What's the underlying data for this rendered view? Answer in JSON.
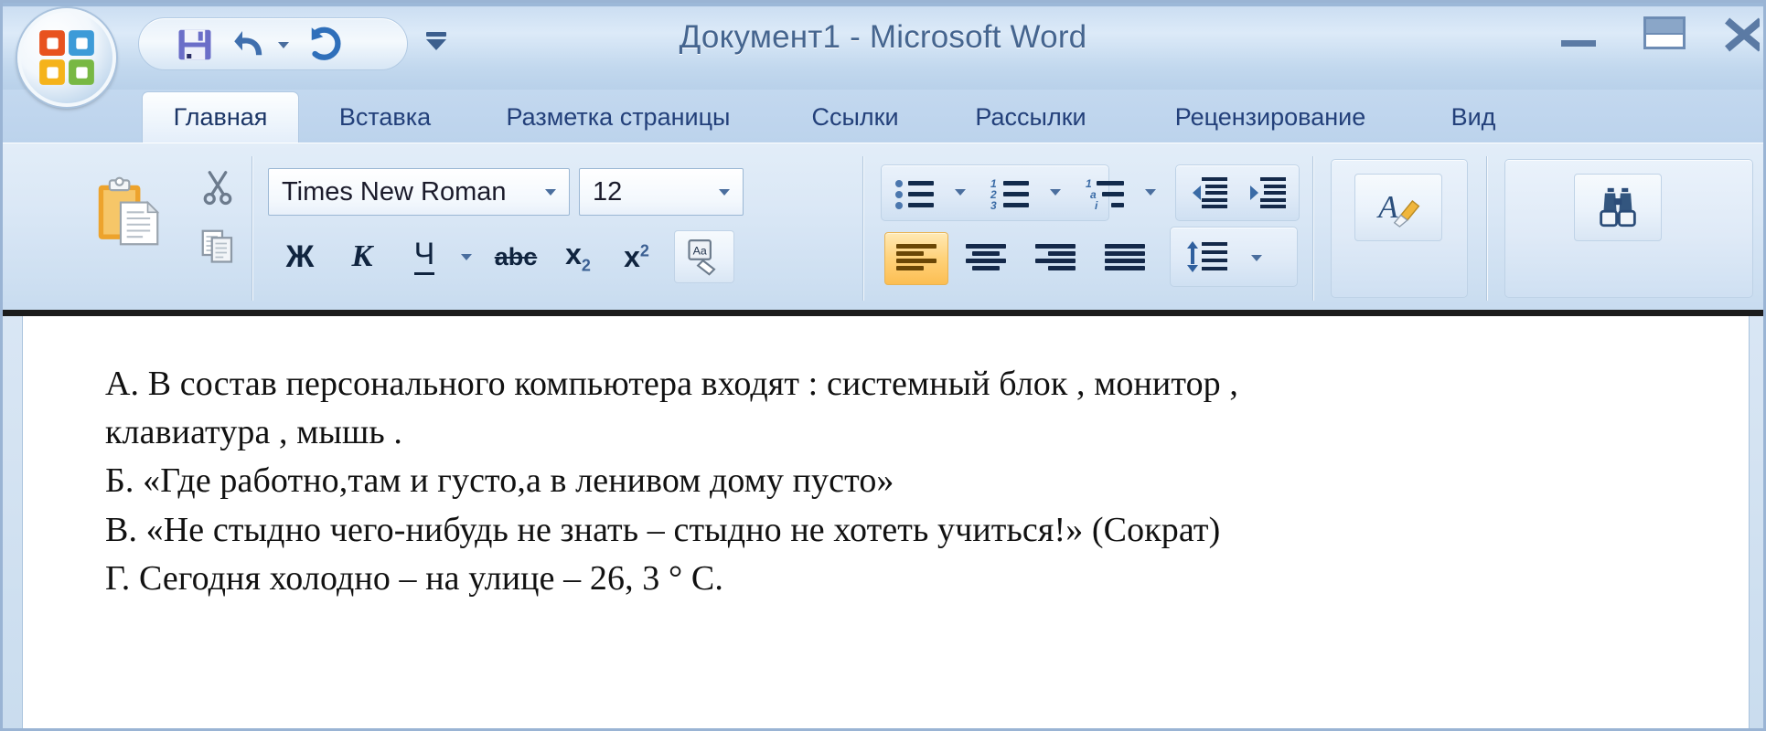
{
  "window": {
    "title": "Документ1 - Microsoft Word",
    "controls": {
      "minimize": "Свернуть",
      "restore": "Восстановить",
      "close": "Закрыть"
    }
  },
  "office_button": {
    "label": "Кнопка Office"
  },
  "quick_access": {
    "items": [
      {
        "name": "save",
        "label": "Сохранить"
      },
      {
        "name": "undo",
        "label": "Отменить"
      },
      {
        "name": "undo-dropdown",
        "label": "Отменить (список)"
      },
      {
        "name": "redo",
        "label": "Вернуть"
      }
    ],
    "customize_label": "Настройка панели быстрого доступа"
  },
  "tabs": [
    {
      "label": "Главная",
      "active": true
    },
    {
      "label": "Вставка",
      "active": false
    },
    {
      "label": "Разметка страницы",
      "active": false
    },
    {
      "label": "Ссылки",
      "active": false
    },
    {
      "label": "Рассылки",
      "active": false
    },
    {
      "label": "Рецензирование",
      "active": false
    },
    {
      "label": "Вид",
      "active": false
    }
  ],
  "ribbon": {
    "clipboard": {
      "paste_label": "Вставить",
      "cut_label": "Вырезать",
      "copy_label": "Копировать"
    },
    "font": {
      "font_name": "Times New Roman",
      "font_size": "12",
      "bold_label": "Ж",
      "italic_label": "К",
      "underline_label": "Ч",
      "strikethrough_label": "abc",
      "subscript_label": "x",
      "subscript_index": "2",
      "superscript_label": "x",
      "superscript_index": "2",
      "clear_format_label": "Очистить формат"
    },
    "paragraph": {
      "bullets_label": "Маркеры",
      "numbering_label": "Нумерация",
      "multilevel_label": "Многоуровневый список",
      "decrease_indent_label": "Уменьшить отступ",
      "increase_indent_label": "Увеличить отступ",
      "align_left_label": "По левому краю",
      "align_center_label": "По центру",
      "align_right_label": "По правому краю",
      "align_justify_label": "По ширине",
      "line_spacing_label": "Междустрочный интервал",
      "active_alignment": "align-left"
    },
    "styles": {
      "change_styles_label": "Изменить стили"
    },
    "editing": {
      "find_label": "Найти"
    }
  },
  "document": {
    "lines": [
      "А. В состав персонального компьютера входят : системный блок , монитор ,",
      "клавиатура , мышь .",
      "Б. «Где работно,там и густо,а в ленивом дому пусто»",
      "В. «Не стыдно чего-нибудь не знать – стыдно не хотеть учиться!» (Сократ)",
      "Г. Сегодня холодно – на улице – 26, 3 ° С."
    ]
  },
  "colors": {
    "titlebar_text": "#45658f",
    "tab_text": "#23407a",
    "accent_orange": "#fcbe53",
    "ribbon_bg": "#dbe8f6"
  }
}
